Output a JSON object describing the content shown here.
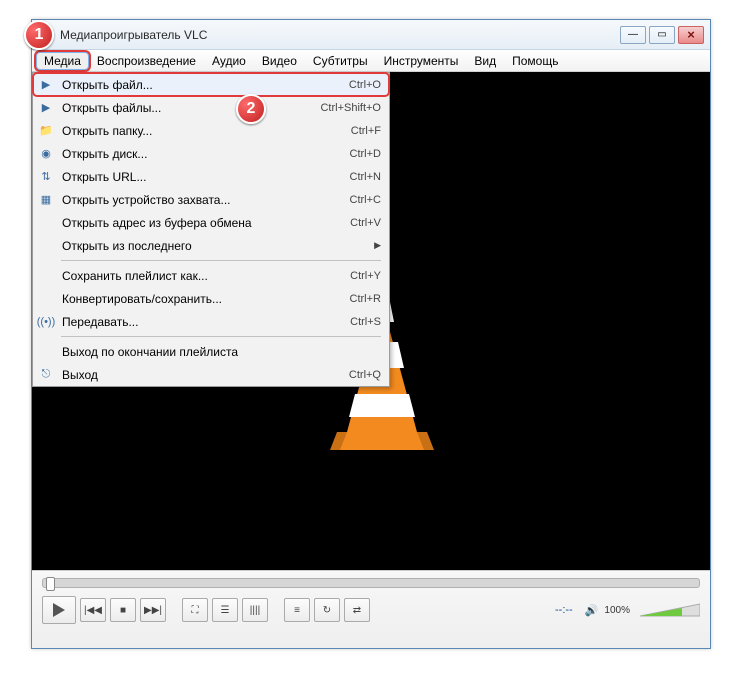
{
  "window": {
    "title": "Медиапроигрыватель VLC"
  },
  "menubar": {
    "items": [
      {
        "label": "Медиа",
        "active": true
      },
      {
        "label": "Воспроизведение"
      },
      {
        "label": "Аудио"
      },
      {
        "label": "Видео"
      },
      {
        "label": "Субтитры"
      },
      {
        "label": "Инструменты"
      },
      {
        "label": "Вид"
      },
      {
        "label": "Помощь"
      }
    ]
  },
  "dropdown": {
    "groups": [
      [
        {
          "icon": "play-file-icon",
          "label": "Открыть файл...",
          "shortcut": "Ctrl+O",
          "highlight": true
        },
        {
          "icon": "play-files-icon",
          "label": "Открыть файлы...",
          "shortcut": "Ctrl+Shift+O"
        },
        {
          "icon": "folder-icon",
          "label": "Открыть папку...",
          "shortcut": "Ctrl+F"
        },
        {
          "icon": "disc-icon",
          "label": "Открыть диск...",
          "shortcut": "Ctrl+D"
        },
        {
          "icon": "network-icon",
          "label": "Открыть URL...",
          "shortcut": "Ctrl+N"
        },
        {
          "icon": "capture-icon",
          "label": "Открыть устройство захвата...",
          "shortcut": "Ctrl+C"
        },
        {
          "icon": "clipboard-icon",
          "label": "Открыть адрес из буфера обмена",
          "shortcut": "Ctrl+V"
        },
        {
          "icon": "",
          "label": "Открыть из последнего",
          "submenu": true
        }
      ],
      [
        {
          "icon": "",
          "label": "Сохранить плейлист как...",
          "shortcut": "Ctrl+Y"
        },
        {
          "icon": "",
          "label": "Конвертировать/сохранить...",
          "shortcut": "Ctrl+R"
        },
        {
          "icon": "stream-icon",
          "label": "Передавать...",
          "shortcut": "Ctrl+S"
        }
      ],
      [
        {
          "icon": "",
          "label": "Выход по окончании плейлиста"
        },
        {
          "icon": "exit-icon",
          "label": "Выход",
          "shortcut": "Ctrl+Q"
        }
      ]
    ]
  },
  "player": {
    "time": "--:--",
    "volume": "100%"
  },
  "callouts": {
    "c1": "1",
    "c2": "2"
  },
  "colors": {
    "accent": "#e13a3a",
    "vlc_orange": "#f28a1f"
  }
}
